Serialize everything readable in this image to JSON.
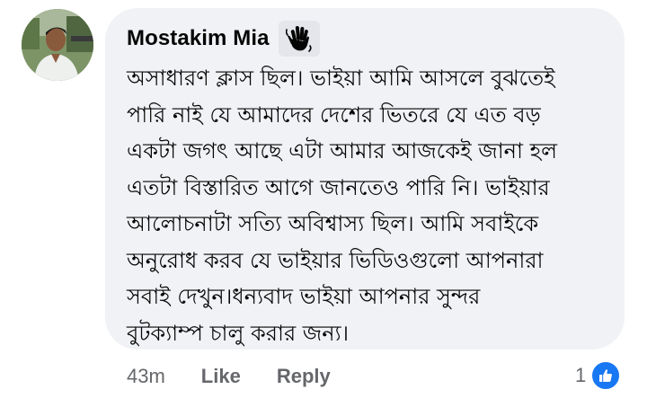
{
  "comment": {
    "author": "Mostakim Mia",
    "author_badge_icon": "waving-hand-icon",
    "text_lines": [
      "অসাধারণ ক্লাস ছিল। ভাইয়া আমি আসলে বুঝতেই",
      "পারি নাই যে আমাদের দেশের ভিতরে যে এত বড়",
      "একটা জগৎ আছে এটা আমার আজকেই জানা হল",
      "এতটা বিস্তারিত আগে  জানতেও পারি নি। ভাইয়ার",
      "আলোচনাটা সত্যি অবিশ্বাস্য ছিল। আমি সবাইকে",
      "অনুরোধ করব যে ভাইয়ার ভিডিওগুলো আপনারা",
      "সবাই দেখুন।ধন্যবাদ ভাইয়া আপনার সুন্দর",
      "বুটক্যাম্প  চালু করার জন্য।"
    ]
  },
  "actions": {
    "time": "43m",
    "like_label": "Like",
    "reply_label": "Reply"
  },
  "reactions": {
    "count": "1",
    "icon": "thumbs-up-icon"
  },
  "colors": {
    "bubble_bg": "#f0f2f5",
    "text": "#050505",
    "secondary_text": "#65676b",
    "like_blue": "#1877f2"
  }
}
